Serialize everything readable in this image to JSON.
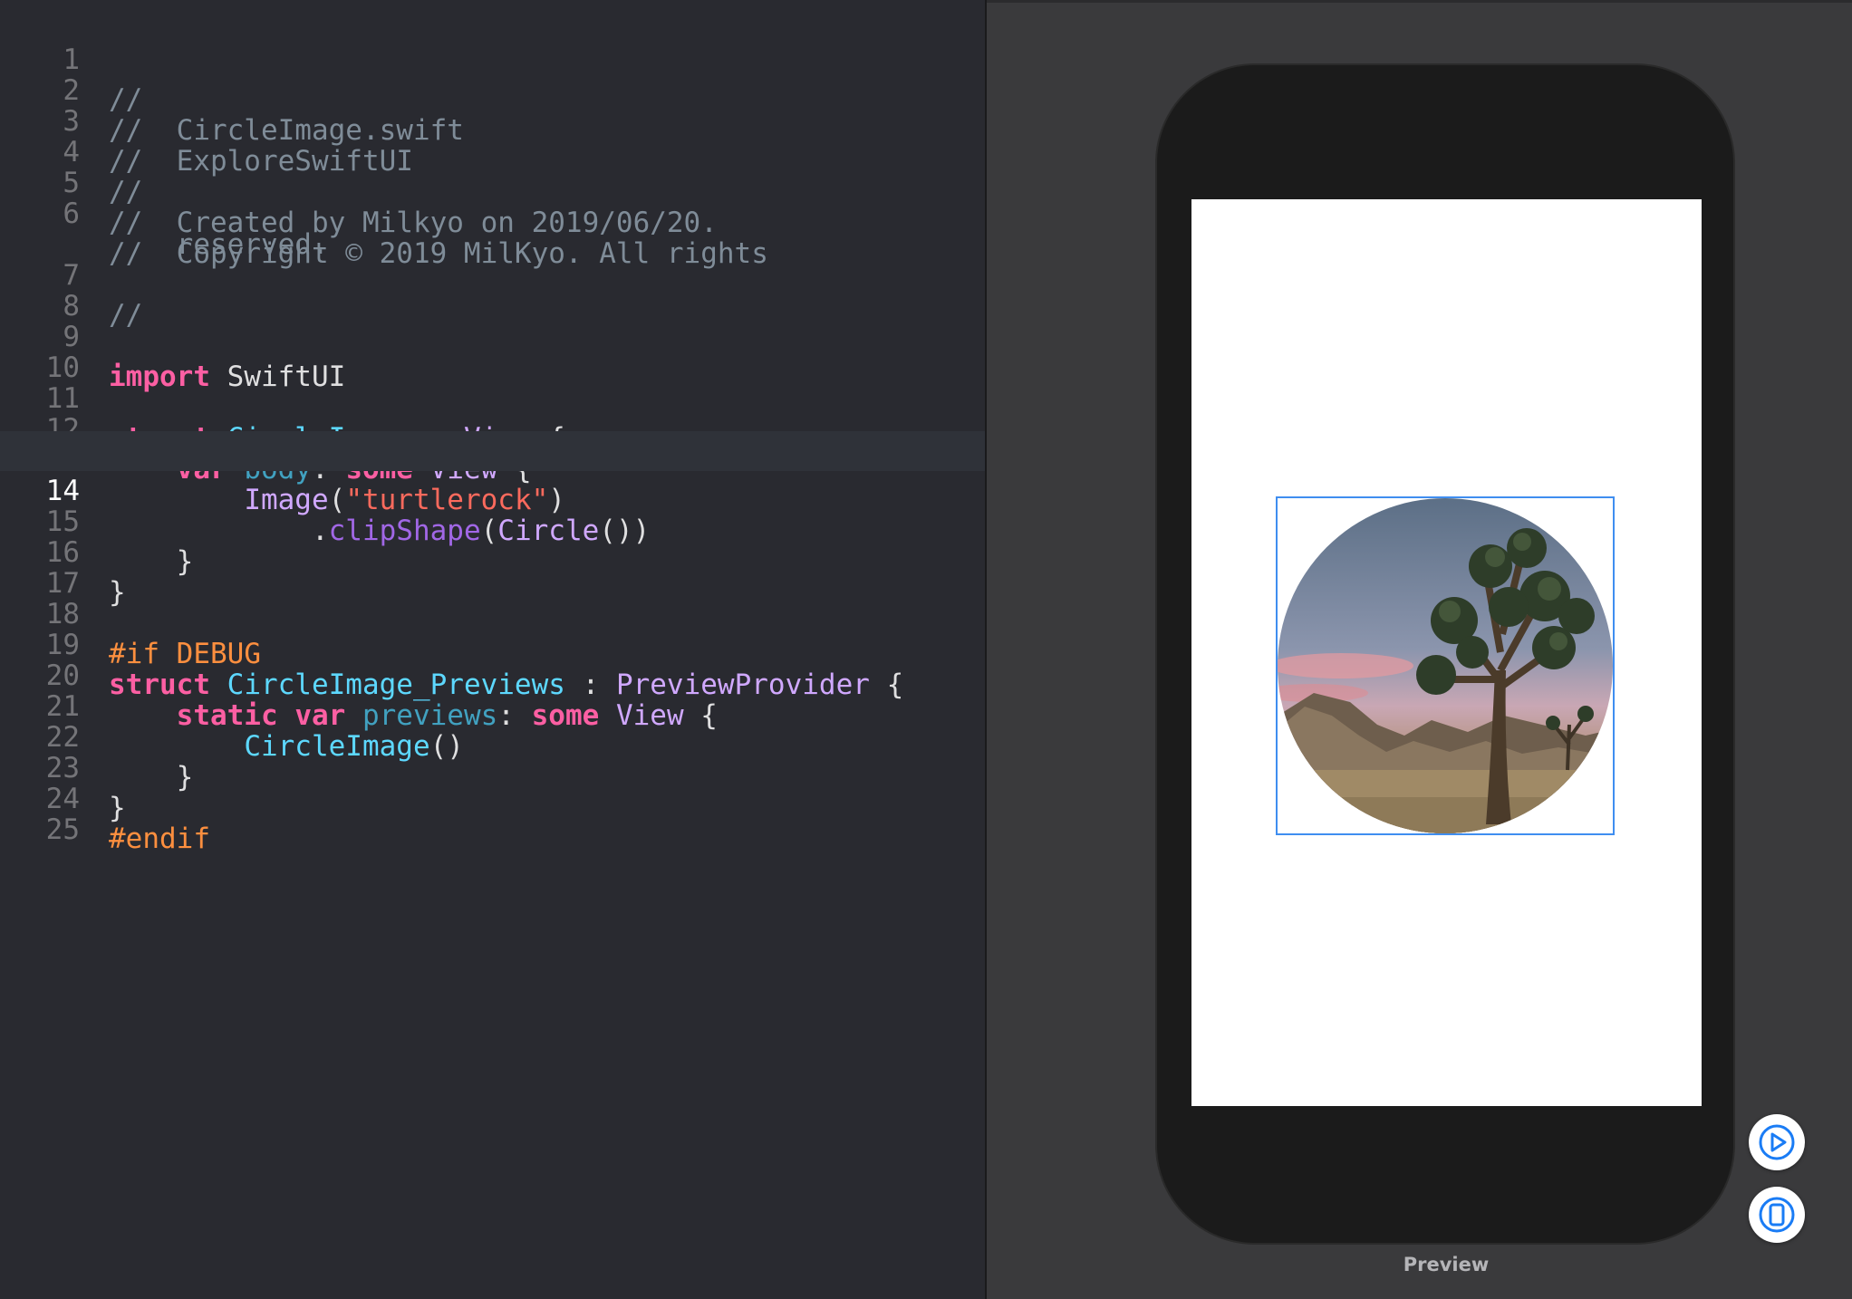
{
  "editor": {
    "current_line": 14,
    "lines": [
      {
        "n": "1"
      },
      {
        "n": "2"
      },
      {
        "n": "3"
      },
      {
        "n": "4"
      },
      {
        "n": "5"
      },
      {
        "n": "6"
      },
      {
        "n": "7"
      },
      {
        "n": "8"
      },
      {
        "n": "9"
      },
      {
        "n": "10"
      },
      {
        "n": "11"
      },
      {
        "n": "12"
      },
      {
        "n": "13"
      },
      {
        "n": "14"
      },
      {
        "n": "15"
      },
      {
        "n": "16"
      },
      {
        "n": "17"
      },
      {
        "n": "18"
      },
      {
        "n": "19"
      },
      {
        "n": "20"
      },
      {
        "n": "21"
      },
      {
        "n": "22"
      },
      {
        "n": "23"
      },
      {
        "n": "24"
      },
      {
        "n": "25"
      }
    ],
    "code": {
      "l1": "//",
      "l2": "//  CircleImage.swift",
      "l3": "//  ExploreSwiftUI",
      "l4": "//",
      "l5": "//  Created by Milkyo on 2019/06/20.",
      "l6a": "//  Copyright © 2019 MilKyo. All rights",
      "l6b": "    reserved.",
      "l7": "//",
      "import_kw": "import",
      "import_mod": "SwiftUI",
      "struct_kw": "struct",
      "struct_name": "CircleImage",
      "colon": " : ",
      "view_type": "View",
      "open_brace": " {",
      "var_kw": "var",
      "body_prop": "body",
      "colon2": ": ",
      "some_kw": "some",
      "image_type": "Image",
      "paren_open": "(",
      "image_str": "\"turtlerock\"",
      "paren_close": ")",
      "dot": ".",
      "clip_method": "clipShape",
      "circle_type": "Circle",
      "clip_tail": "())",
      "close_brace": "}",
      "if_debug_kw": "#if",
      "debug_flag": "DEBUG",
      "preview_struct": "CircleImage_Previews",
      "provider": "PreviewProvider",
      "static_kw": "static",
      "previews_prop": "previews",
      "circleimage_call": "CircleImage",
      "call_parens": "()",
      "endif_kw": "#endif"
    }
  },
  "preview": {
    "label": "Preview",
    "image_name": "turtlerock",
    "live_button_icon": "play-circle-icon",
    "device_button_icon": "device-icon",
    "selection_color": "#3f8ef0"
  }
}
